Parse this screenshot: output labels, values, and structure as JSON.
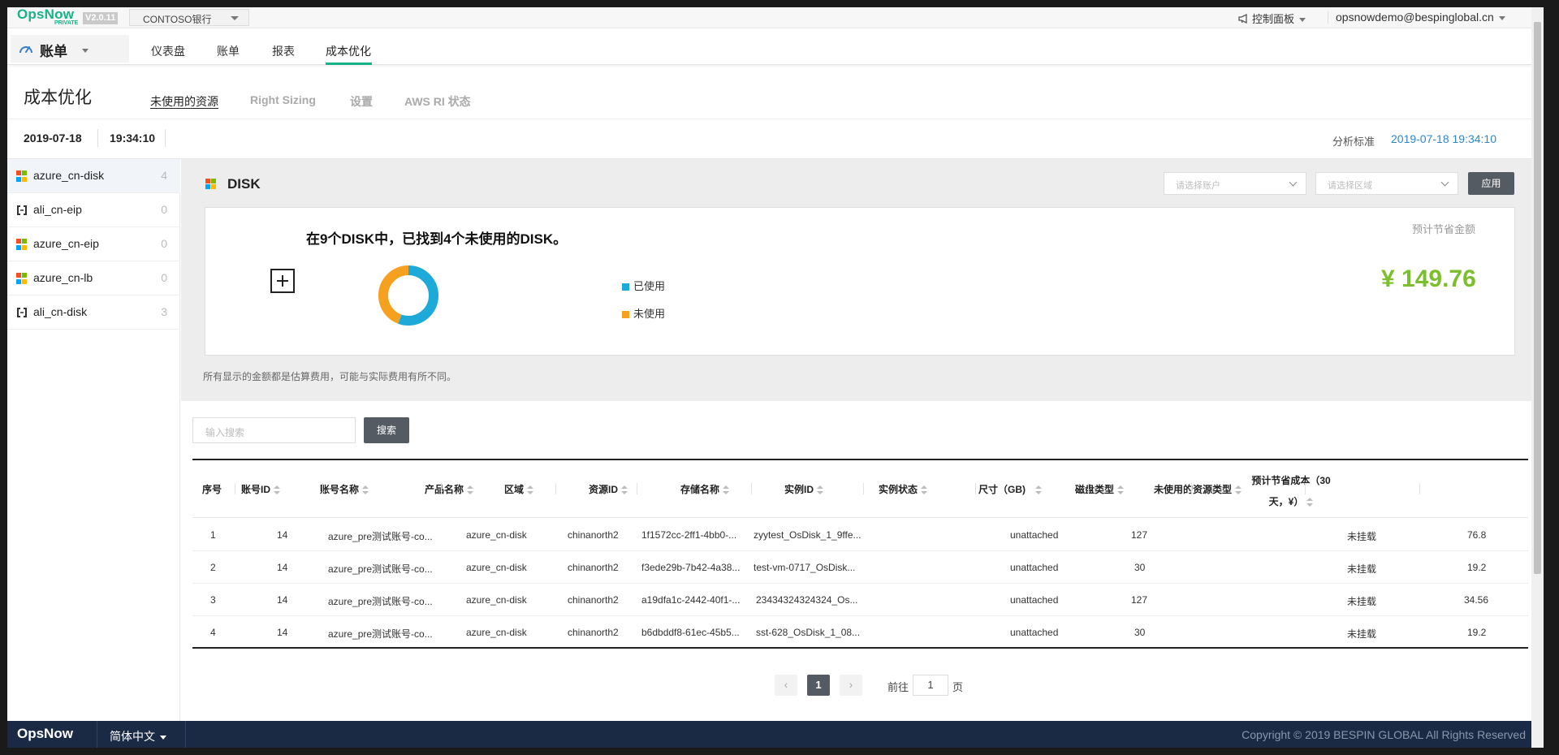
{
  "topbar": {
    "logo_name": "OpsNow",
    "logo_sub": "PRIVATE",
    "version": "V2.0.11",
    "tenant": "CONTOSO银行",
    "control_panel": "控制面板",
    "user": "opsnowdemo@bespinglobal.cn"
  },
  "nav": {
    "module": "账单",
    "tabs": [
      "仪表盘",
      "账单",
      "报表",
      "成本优化"
    ],
    "active_tab": "成本优化"
  },
  "page": {
    "title": "成本优化",
    "subtabs": [
      "未使用的资源",
      "Right Sizing",
      "设置",
      "AWS RI 状态"
    ],
    "date": "2019-07-18",
    "time": "19:34:10",
    "analysis_label": "分析标准",
    "analysis_date": "2019-07-18 19:34:10"
  },
  "sidebar": {
    "items": [
      {
        "label": "azure_cn-disk",
        "count": "4",
        "icon": "windows-icon"
      },
      {
        "label": "ali_cn-eip",
        "count": "0",
        "icon": "alibaba-icon"
      },
      {
        "label": "azure_cn-eip",
        "count": "0",
        "icon": "windows-icon"
      },
      {
        "label": "azure_cn-lb",
        "count": "0",
        "icon": "windows-icon"
      },
      {
        "label": "ali_cn-disk",
        "count": "3",
        "icon": "alibaba-icon"
      }
    ]
  },
  "panel": {
    "title": "DISK",
    "account_placeholder": "请选择账户",
    "region_placeholder": "请选择区域",
    "apply": "应用",
    "summary": "在9个DISK中，已找到4个未使用的DISK。",
    "legend_used": "已使用",
    "legend_unused": "未使用",
    "save_label": "预计节省金额",
    "save_value": "¥ 149.76",
    "note": "所有显示的金额都是估算费用，可能与实际费用有所不同。",
    "colors": {
      "used": "#1eaad9",
      "unused": "#f5a11f",
      "save": "#7cbf2c",
      "accent": "#17b288"
    }
  },
  "chart_data": {
    "type": "pie",
    "categories": [
      "已使用",
      "未使用"
    ],
    "values": [
      5,
      4
    ]
  },
  "search": {
    "placeholder": "输入搜索",
    "button": "搜索"
  },
  "table": {
    "headers": [
      "序号",
      "账号ID",
      "账号名称",
      "产品名称",
      "区域",
      "资源ID",
      "存储名称",
      "实例ID",
      "实例状态",
      "尺寸（GB)",
      "磁盘类型",
      "未使用的资源类型",
      "预计节省成本（30天，¥）"
    ],
    "header_last_line1": "预计节省成本（30",
    "header_last_line2": "天，¥）",
    "rows": [
      [
        "1",
        "14",
        "azure_pre测试账号-co...",
        "azure_cn-disk",
        "chinanorth2",
        "1f1572cc-2ff1-4bb0-...",
        "zyytest_OsDisk_1_9ffe...",
        "",
        "unattached",
        "127",
        "",
        "未挂载",
        "76.8"
      ],
      [
        "2",
        "14",
        "azure_pre测试账号-co...",
        "azure_cn-disk",
        "chinanorth2",
        "f3ede29b-7b42-4a38...",
        "test-vm-0717_OsDisk...",
        "",
        "unattached",
        "30",
        "",
        "未挂载",
        "19.2"
      ],
      [
        "3",
        "14",
        "azure_pre测试账号-co...",
        "azure_cn-disk",
        "chinanorth2",
        "a19dfa1c-2442-40f1-...",
        "23434324324324_Os...",
        "",
        "unattached",
        "127",
        "",
        "未挂载",
        "34.56"
      ],
      [
        "4",
        "14",
        "azure_pre测试账号-co...",
        "azure_cn-disk",
        "chinanorth2",
        "b6dbddf8-61ec-45b5...",
        "sst-628_OsDisk_1_08...",
        "",
        "unattached",
        "30",
        "",
        "未挂载",
        "19.2"
      ]
    ]
  },
  "pagination": {
    "prev": "‹",
    "current": "1",
    "next": "›",
    "goto_label": "前往",
    "goto_value": "1",
    "page_label": "页"
  },
  "footer": {
    "brand": "OpsNow",
    "language": "简体中文",
    "copyright": "Copyright © 2019 BESPIN GLOBAL All Rights Reserved"
  }
}
